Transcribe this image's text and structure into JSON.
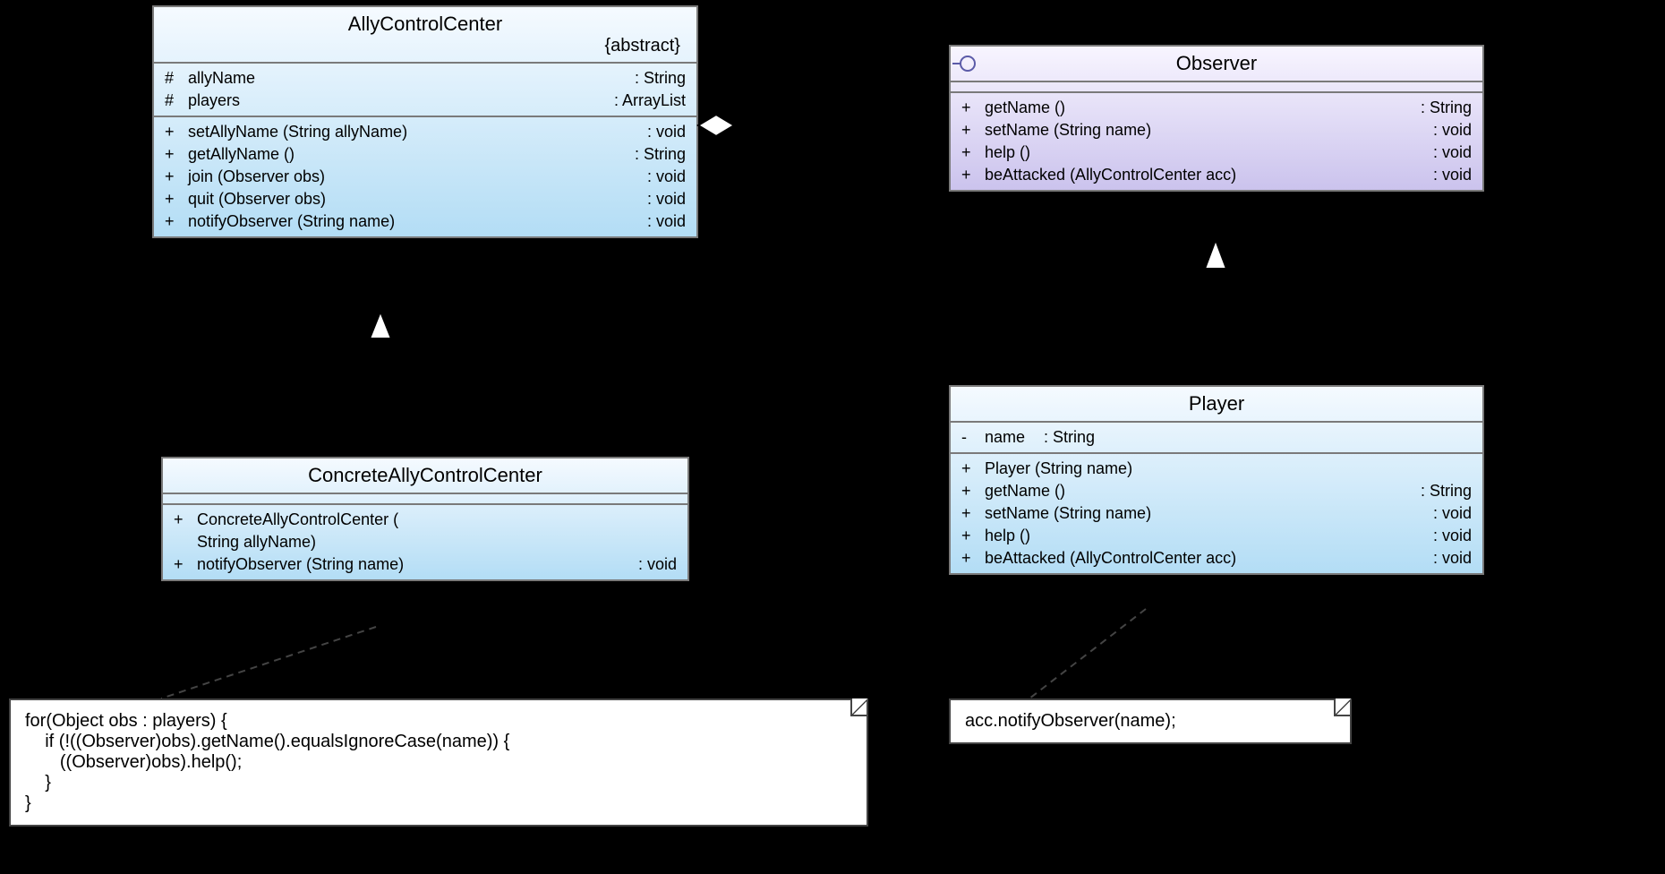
{
  "classes": {
    "allyControlCenter": {
      "name": "AllyControlCenter",
      "stereotype": "{abstract}",
      "attrs": [
        {
          "vis": "#",
          "name": "allyName",
          "type": ": String"
        },
        {
          "vis": "#",
          "name": "players",
          "type": ": ArrayList"
        }
      ],
      "methods": [
        {
          "vis": "+",
          "sig": "setAllyName (String allyName)",
          "ret": ": void"
        },
        {
          "vis": "+",
          "sig": "getAllyName ()",
          "ret": ": String"
        },
        {
          "vis": "+",
          "sig": "join (Observer obs)",
          "ret": ": void"
        },
        {
          "vis": "+",
          "sig": "quit (Observer obs)",
          "ret": ": void"
        },
        {
          "vis": "+",
          "sig": "notifyObserver (String name)",
          "ret": ": void"
        }
      ]
    },
    "observer": {
      "name": "Observer",
      "methods": [
        {
          "vis": "+",
          "sig": "getName ()",
          "ret": ": String"
        },
        {
          "vis": "+",
          "sig": "setName (String name)",
          "ret": ": void"
        },
        {
          "vis": "+",
          "sig": "help ()",
          "ret": ": void"
        },
        {
          "vis": "+",
          "sig": "beAttacked (AllyControlCenter acc)",
          "ret": ": void"
        }
      ]
    },
    "concrete": {
      "name": "ConcreteAllyControlCenter",
      "methods": [
        {
          "vis": "+",
          "sig": "ConcreteAllyControlCenter (",
          "ret": ""
        },
        {
          "vis": "",
          "sig": "    String allyName)",
          "ret": ""
        },
        {
          "vis": "+",
          "sig": "notifyObserver (String name)",
          "ret": ": void"
        }
      ]
    },
    "player": {
      "name": "Player",
      "attrs": [
        {
          "vis": "-",
          "name": "name",
          "type": ": String"
        }
      ],
      "methods": [
        {
          "vis": "+",
          "sig": "Player (String name)",
          "ret": ""
        },
        {
          "vis": "+",
          "sig": "getName ()",
          "ret": ": String"
        },
        {
          "vis": "+",
          "sig": "setName (String name)",
          "ret": ": void"
        },
        {
          "vis": "+",
          "sig": "help ()",
          "ret": ": void"
        },
        {
          "vis": "+",
          "sig": "beAttacked (AllyControlCenter acc)",
          "ret": ": void"
        }
      ]
    }
  },
  "notes": {
    "left": "for(Object obs : players) {\n    if (!((Observer)obs).getName().equalsIgnoreCase(name)) {\n       ((Observer)obs).help();\n    }\n}",
    "right": "acc.notifyObserver(name);"
  }
}
